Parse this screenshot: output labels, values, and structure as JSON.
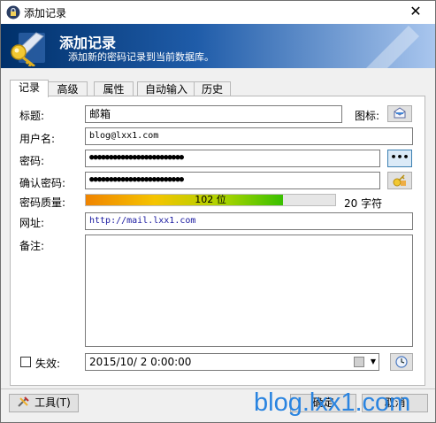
{
  "window": {
    "title": "添加记录",
    "close_glyph": "✕"
  },
  "banner": {
    "title": "添加记录",
    "subtitle": "添加新的密码记录到当前数据库。"
  },
  "tabs": [
    {
      "label": "记录",
      "active": true
    },
    {
      "label": "高级",
      "active": false
    },
    {
      "label": "属性",
      "active": false
    },
    {
      "label": "自动输入",
      "active": false
    },
    {
      "label": "历史",
      "active": false
    }
  ],
  "form": {
    "title_label": "标题:",
    "title_value": "邮箱",
    "icon_label": "图标:",
    "username_label": "用户名:",
    "username_value": "blog@lxx1.com",
    "password_label": "密码:",
    "password_value": "●●●●●●●●●●●●●●●●●●●●●●●●",
    "show_password_button": "•••",
    "confirm_label": "确认密码:",
    "confirm_value": "●●●●●●●●●●●●●●●●●●●●●●●●",
    "quality_label": "密码质量:",
    "quality_bits_text": "102 位",
    "quality_fraction": 0.79,
    "quality_chars_text": "20 字符",
    "url_label": "网址:",
    "url_value": "http://mail.lxx1.com",
    "notes_label": "备注:",
    "notes_value": "",
    "expires_label": "失效:",
    "expires_checked": false,
    "expires_value": "2015/10/ 2  0:00:00"
  },
  "footer": {
    "tools_button": "工具(T)",
    "ok_button": "确定",
    "cancel_button": "取消",
    "watermark": "blog.lxx1.com"
  },
  "colors": {
    "banner_dark": "#00306a",
    "banner_light": "#a9c6ee",
    "url_text": "#1a1aa0",
    "watermark": "#2a84e0"
  }
}
